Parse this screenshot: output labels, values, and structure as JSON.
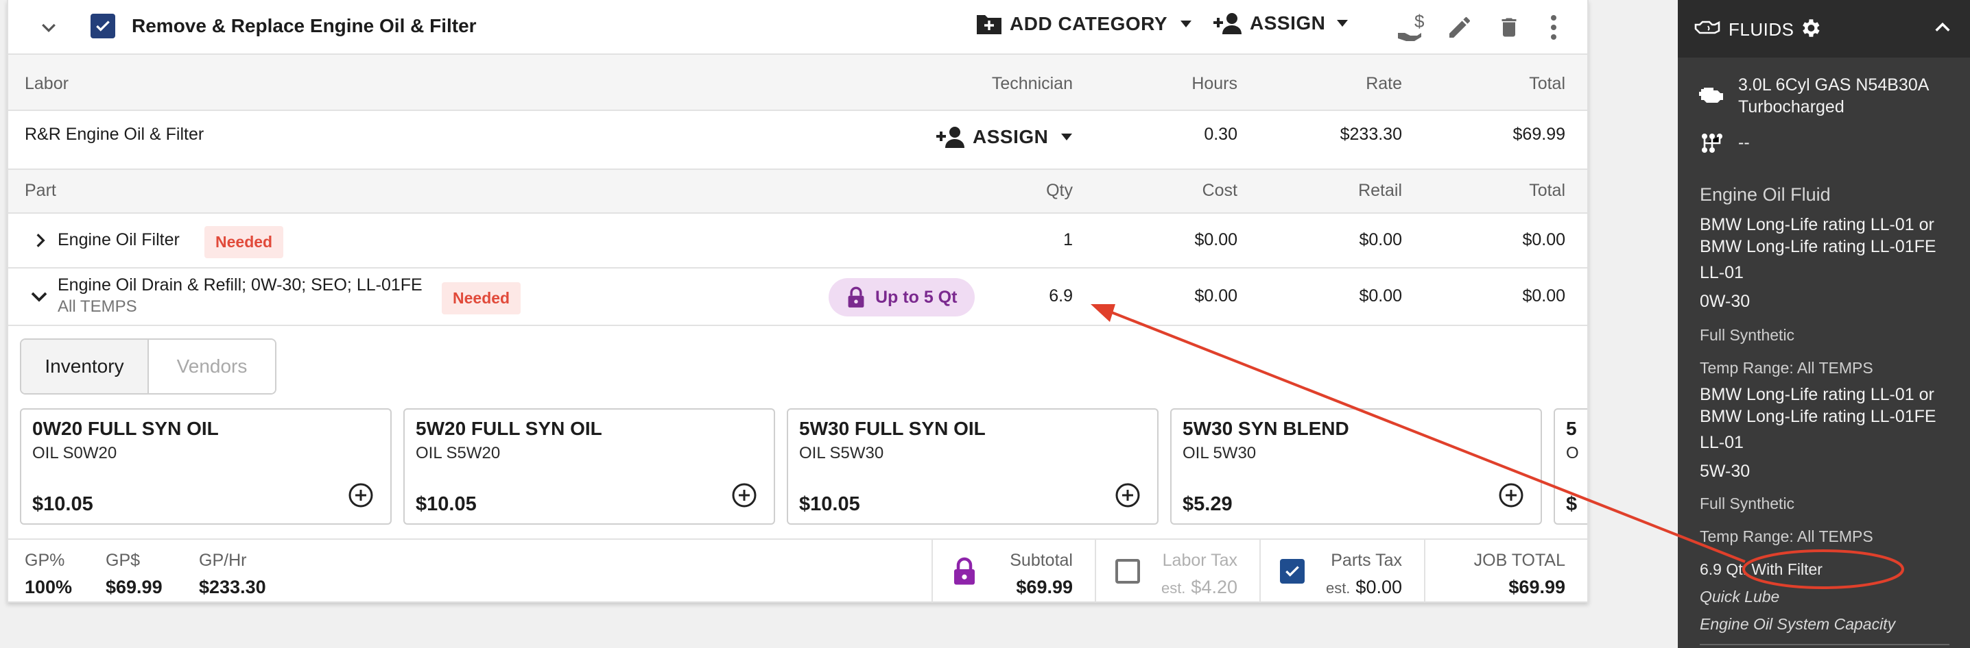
{
  "job": {
    "title": "Remove & Replace Engine Oil & Filter",
    "add_category_label": "ADD CATEGORY",
    "assign_label": "ASSIGN"
  },
  "labor": {
    "headers": {
      "name": "Labor",
      "technician": "Technician",
      "hours": "Hours",
      "rate": "Rate",
      "total": "Total"
    },
    "row": {
      "name": "R&R Engine Oil & Filter",
      "assign_label": "ASSIGN",
      "hours": "0.30",
      "rate": "$233.30",
      "total": "$69.99"
    }
  },
  "parts": {
    "headers": {
      "name": "Part",
      "qty": "Qty",
      "cost": "Cost",
      "retail": "Retail",
      "total": "Total"
    },
    "rows": [
      {
        "name": "Engine Oil Filter",
        "badge": "Needed",
        "qty": "1",
        "cost": "$0.00",
        "retail": "$0.00",
        "total": "$0.00"
      },
      {
        "name": "Engine Oil Drain & Refill; 0W-30; SEO; LL-01FE",
        "subtext": "All TEMPS",
        "badge": "Needed",
        "pill": "Up to 5 Qt",
        "qty": "6.9",
        "cost": "$0.00",
        "retail": "$0.00",
        "total": "$0.00"
      }
    ]
  },
  "tabs": {
    "inventory": "Inventory",
    "vendors": "Vendors"
  },
  "products": [
    {
      "name": "0W20 FULL SYN OIL",
      "sku": "OIL S0W20",
      "price": "$10.05"
    },
    {
      "name": "5W20 FULL SYN OIL",
      "sku": "OIL S5W20",
      "price": "$10.05"
    },
    {
      "name": "5W30 FULL SYN OIL",
      "sku": "OIL S5W30",
      "price": "$10.05"
    },
    {
      "name": "5W30 SYN BLEND",
      "sku": "OIL 5W30",
      "price": "$5.29"
    },
    {
      "name": "5",
      "sku": "O",
      "price": "$"
    }
  ],
  "footer": {
    "gp_pct_label": "GP%",
    "gp_pct": "100%",
    "gp_dollar_label": "GP$",
    "gp_dollar": "$69.99",
    "gp_hr_label": "GP/Hr",
    "gp_hr": "$233.30",
    "subtotal_label": "Subtotal",
    "subtotal": "$69.99",
    "labor_tax_label": "Labor Tax",
    "labor_tax_est": "est.",
    "labor_tax": "$4.20",
    "parts_tax_label": "Parts Tax",
    "parts_tax_est": "est.",
    "parts_tax": "$0.00",
    "job_total_label": "JOB TOTAL",
    "job_total": "$69.99"
  },
  "panel": {
    "title": "FLUIDS",
    "engine_line1": "3.0L 6Cyl GAS N54B30A",
    "engine_line2": "Turbocharged",
    "trans": "--",
    "section_title": "Engine Oil Fluid",
    "spec1_line1": "BMW Long-Life rating LL-01 or",
    "spec1_line2": "BMW Long-Life rating LL-01FE",
    "spec1_line3": "LL-01",
    "viscosity1": "0W-30",
    "type1": "Full Synthetic",
    "temp1": "Temp Range: All TEMPS",
    "spec2_line1": "BMW Long-Life rating LL-01 or",
    "spec2_line2": "BMW Long-Life rating LL-01FE",
    "spec2_line3": "LL-01",
    "viscosity2": "5W-30",
    "type2": "Full Synthetic",
    "temp2": "Temp Range: All TEMPS",
    "capacity": "6.9 Qt. With Filter",
    "quick_lube": "Quick Lube",
    "system_capacity": "Engine Oil System Capacity"
  },
  "colors": {
    "accent_purple": "#7b2a8f",
    "badge_red": "#e14a3a",
    "annotation_red": "#e0402b",
    "checkbox_blue": "#243f7a"
  }
}
